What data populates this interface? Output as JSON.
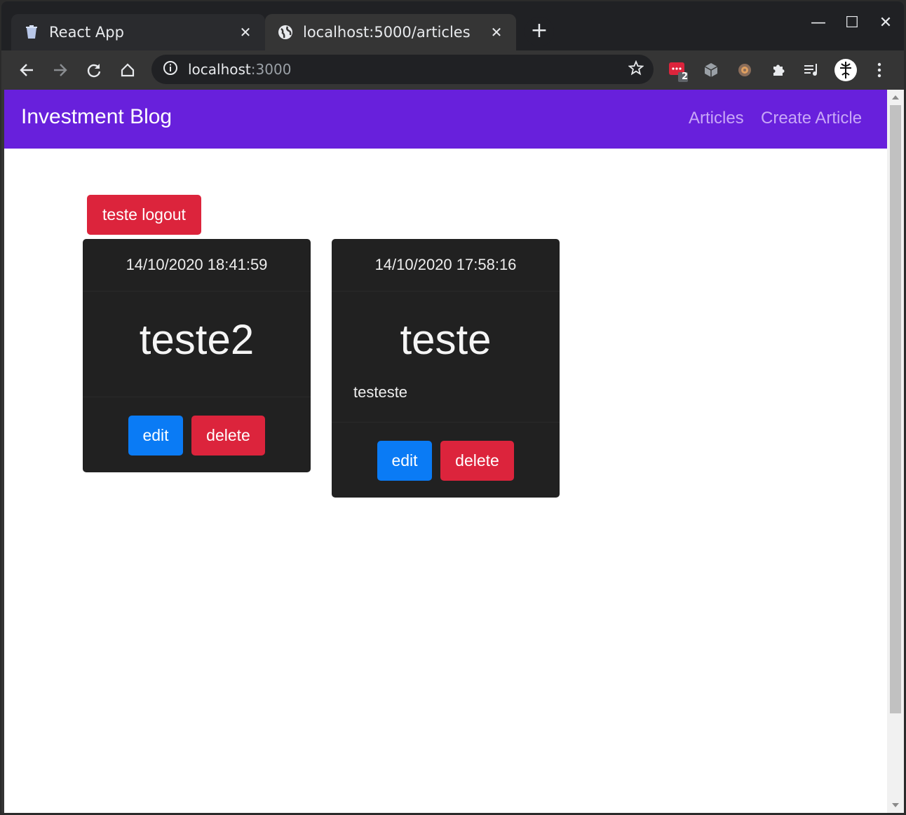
{
  "browser": {
    "tabs": [
      {
        "title": "React App",
        "active": false,
        "favicon": "trash-can-icon"
      },
      {
        "title": "localhost:5000/articles",
        "active": true,
        "favicon": "globe-icon"
      }
    ],
    "address": {
      "host": "localhost",
      "port": ":3000"
    },
    "extension_badge": "2"
  },
  "app": {
    "brand": "Investment Blog",
    "nav": [
      "Articles",
      "Create Article"
    ],
    "logout_label": "teste logout",
    "articles": [
      {
        "date": "14/10/2020 18:41:59",
        "title": "teste2",
        "text": "",
        "edit_label": "edit",
        "delete_label": "delete"
      },
      {
        "date": "14/10/2020 17:58:16",
        "title": "teste",
        "text": "testeste",
        "edit_label": "edit",
        "delete_label": "delete"
      }
    ]
  },
  "colors": {
    "navbar": "#6820dc",
    "danger": "#dc243c",
    "primary": "#0a7bf5",
    "card": "#212121"
  }
}
